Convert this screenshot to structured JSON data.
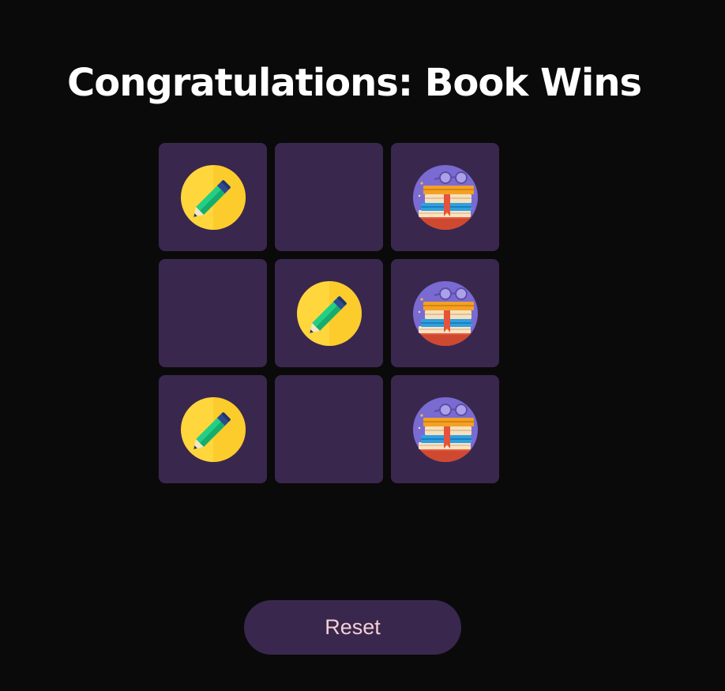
{
  "header": {
    "title": "Congratulations: Book Wins"
  },
  "board": {
    "cells": [
      "pencil",
      "",
      "book",
      "",
      "pencil",
      "book",
      "pencil",
      "",
      "book"
    ]
  },
  "icons": {
    "pencil": "pencil-icon",
    "book": "book-stack-icon"
  },
  "controls": {
    "reset_label": "Reset"
  },
  "colors": {
    "background": "#0a0a0a",
    "cell": "#3a274e",
    "title": "#ffffff",
    "button_text": "#f3cfd3"
  }
}
